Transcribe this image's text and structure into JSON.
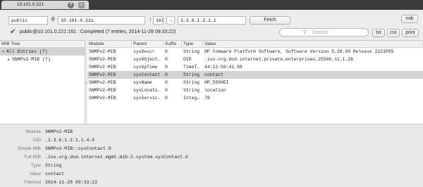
{
  "tab": {
    "title": "10.101.0.221",
    "help_label": "?",
    "close_label": "x"
  },
  "toolbar": {
    "community": "public",
    "at_sign": "@",
    "host": "10.101.0.221",
    "port_sep": ":",
    "port": "161",
    "dropdown_icon": "chevron-down-icon",
    "oid": "1.3.6.1.2.1.1",
    "fetch_label": "Fetch",
    "mib_label": "mib"
  },
  "status": {
    "text": "public@10.101.0.221:161 : Completed (7 entries, 2014-11-28 09:33:22)",
    "color": "#27a030"
  },
  "search": {
    "placeholder": "Search"
  },
  "export": {
    "txt": "txt",
    "csv": "csv",
    "print": "print"
  },
  "tree": {
    "header": "MIB Tree",
    "items": [
      {
        "label": "All Entries (7)"
      },
      {
        "label": "SNMPv2-MIB (7)"
      }
    ]
  },
  "table": {
    "columns": [
      "Module",
      "Parent",
      "Suffix",
      "Type",
      "Value"
    ],
    "rows": [
      [
        "SNMPv2-MIB",
        "sysDescr",
        "0",
        "String",
        "HP Comware Platform Software, Software Version 5.20.99 Release 2221P05"
      ],
      [
        "SNMPv2-MIB",
        "sysObject…",
        "0",
        "OID",
        ".iso.org.dod.internet.private.enterprises.25506.11.1.26"
      ],
      [
        "SNMPv2-MIB",
        "sysUpTime",
        "0",
        "TimeT…",
        "44:12:56:41.98"
      ],
      [
        "SNMPv2-MIB",
        "sysContact",
        "0",
        "String",
        "contact"
      ],
      [
        "SNMPv2-MIB",
        "sysName",
        "0",
        "String",
        "HP_5500EI"
      ],
      [
        "SNMPv2-MIB",
        "sysLocati…",
        "0",
        "String",
        "location"
      ],
      [
        "SNMPv2-MIB",
        "sysServic…",
        "0",
        "Integ…",
        "78"
      ]
    ],
    "selected_row": 3
  },
  "details": {
    "labels": [
      "Module",
      "OID",
      "Simple MIB",
      "Full MIB",
      "Type",
      "Value",
      "Fetched"
    ],
    "values": [
      "SNMPv2-MIB",
      ".1.3.6.1.2.1.1.4.0",
      "SNMPv2-MIB::sysContact.0",
      ".iso.org.dod.internet.mgmt.mib-2.system.sysContact.0",
      "String",
      "contact",
      "2014-11-28 09:33:22"
    ]
  }
}
